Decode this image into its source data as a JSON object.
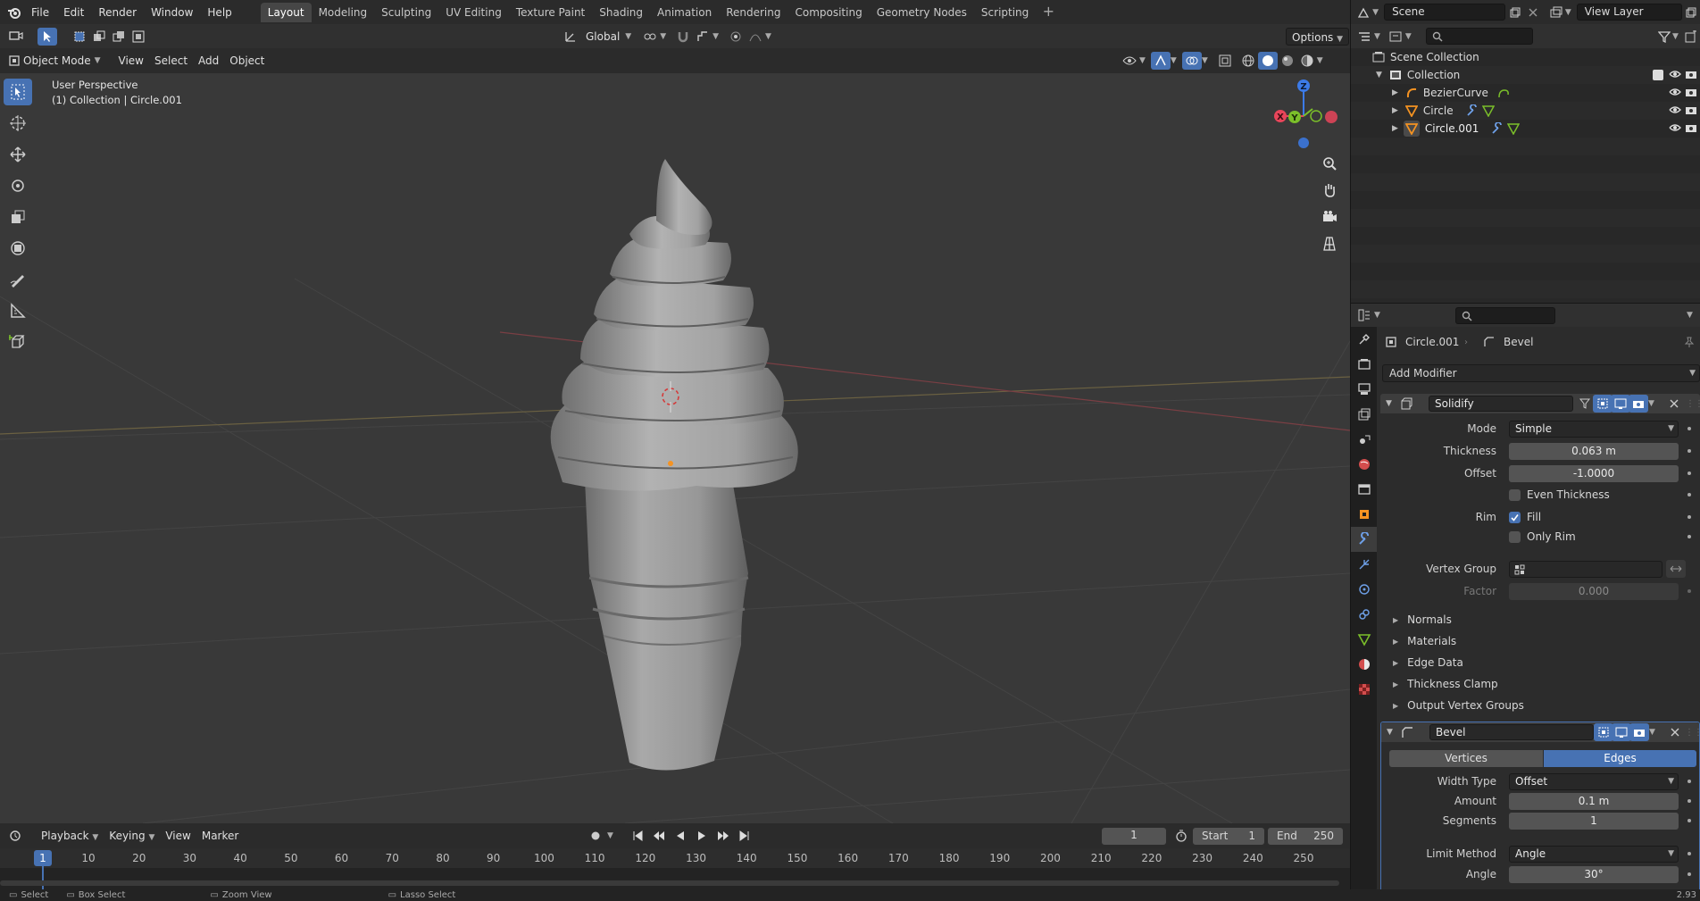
{
  "menu": [
    "File",
    "Edit",
    "Render",
    "Window",
    "Help"
  ],
  "workspaces": [
    "Layout",
    "Modeling",
    "Sculpting",
    "UV Editing",
    "Texture Paint",
    "Shading",
    "Animation",
    "Rendering",
    "Compositing",
    "Geometry Nodes",
    "Scripting"
  ],
  "workspace_add": "+",
  "scene": "Scene",
  "view_layer": "View Layer",
  "viewport_header": {
    "orientation": "Global",
    "options": "Options"
  },
  "tool_header": {
    "mode": "Object Mode",
    "menus": [
      "View",
      "Select",
      "Add",
      "Object"
    ]
  },
  "viewport_info": {
    "line1": "User Perspective",
    "line2": "(1) Collection | Circle.001"
  },
  "gizmo": {
    "x": "X",
    "y": "Y",
    "z": "Z"
  },
  "outliner": {
    "scene_collection": "Scene Collection",
    "collection": "Collection",
    "objects": [
      "BezierCurve",
      "Circle",
      "Circle.001"
    ]
  },
  "properties": {
    "breadcrumb_object": "Circle.001",
    "breadcrumb_modifier": "Bevel",
    "add_modifier": "Add Modifier",
    "solidify": {
      "name": "Solidify",
      "mode_label": "Mode",
      "mode": "Simple",
      "thickness_label": "Thickness",
      "thickness": "0.063 m",
      "offset_label": "Offset",
      "offset": "-1.0000",
      "even_thickness": "Even Thickness",
      "rim_label": "Rim",
      "fill": "Fill",
      "only_rim": "Only Rim",
      "vertex_group_label": "Vertex Group",
      "factor_label": "Factor",
      "factor": "0.000",
      "subpanels": [
        "Normals",
        "Materials",
        "Edge Data",
        "Thickness Clamp",
        "Output Vertex Groups"
      ]
    },
    "bevel": {
      "name": "Bevel",
      "vertices": "Vertices",
      "edges": "Edges",
      "width_type_label": "Width Type",
      "width_type": "Offset",
      "amount_label": "Amount",
      "amount": "0.1 m",
      "segments_label": "Segments",
      "segments": "1",
      "limit_method_label": "Limit Method",
      "limit_method": "Angle",
      "angle_label": "Angle",
      "angle": "30°"
    }
  },
  "timeline": {
    "menus": [
      "Playback",
      "Keying",
      "View",
      "Marker"
    ],
    "current_frame": "1",
    "start_label": "Start",
    "start": "1",
    "end_label": "End",
    "end": "250",
    "ticks": [
      "10",
      "20",
      "30",
      "40",
      "50",
      "60",
      "70",
      "80",
      "90",
      "100",
      "110",
      "120",
      "130",
      "140",
      "150",
      "160",
      "170",
      "180",
      "190",
      "200",
      "210",
      "220",
      "230",
      "240",
      "250"
    ],
    "playhead": "1"
  },
  "statusbar": {
    "items": [
      "Select",
      "Box Select",
      "Zoom View",
      "Lasso Select"
    ],
    "version": "2.93"
  },
  "colors": {
    "accent": "#4772b3",
    "x_axis": "#e8455a",
    "y_axis": "#7bbf2a",
    "z_axis": "#3c7be8",
    "origin": "#f59322"
  }
}
